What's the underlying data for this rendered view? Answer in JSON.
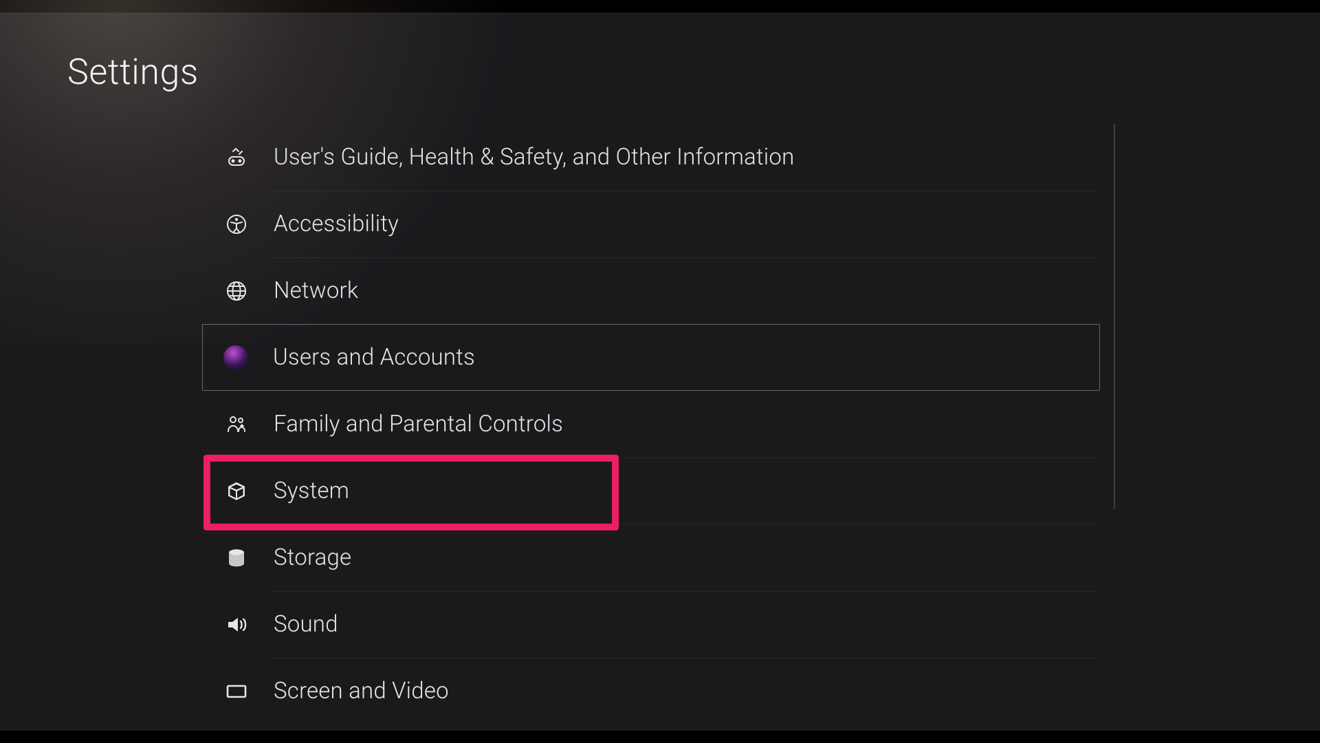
{
  "title": "Settings",
  "selected_index": 3,
  "annotated_index": 5,
  "menu": [
    {
      "id": "guide",
      "label": "User's Guide, Health & Safety, and Other Information",
      "icon": "gamepad-info-icon"
    },
    {
      "id": "accessibility",
      "label": "Accessibility",
      "icon": "accessibility-icon"
    },
    {
      "id": "network",
      "label": "Network",
      "icon": "globe-icon"
    },
    {
      "id": "users",
      "label": "Users and Accounts",
      "icon": "avatar-icon"
    },
    {
      "id": "family",
      "label": "Family and Parental Controls",
      "icon": "family-icon"
    },
    {
      "id": "system",
      "label": "System",
      "icon": "cube-icon"
    },
    {
      "id": "storage",
      "label": "Storage",
      "icon": "storage-icon"
    },
    {
      "id": "sound",
      "label": "Sound",
      "icon": "speaker-icon"
    },
    {
      "id": "screen",
      "label": "Screen and Video",
      "icon": "screen-icon"
    }
  ],
  "annotation_color": "#ed1e62"
}
